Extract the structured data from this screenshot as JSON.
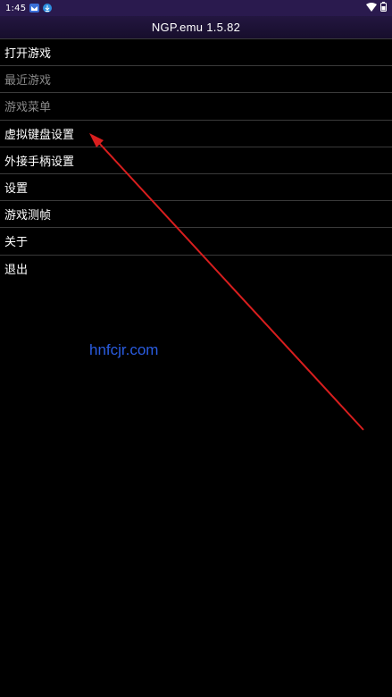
{
  "status_bar": {
    "time": "1:45"
  },
  "app_bar": {
    "title": "NGP.emu 1.5.82"
  },
  "menu": {
    "items": [
      {
        "label": "打开游戏",
        "enabled": true
      },
      {
        "label": "最近游戏",
        "enabled": false
      },
      {
        "label": "游戏菜单",
        "enabled": false
      },
      {
        "label": "虚拟键盘设置",
        "enabled": true
      },
      {
        "label": "外接手柄设置",
        "enabled": true
      },
      {
        "label": "设置",
        "enabled": true
      },
      {
        "label": "游戏测帧",
        "enabled": true
      },
      {
        "label": "关于",
        "enabled": true
      },
      {
        "label": "退出",
        "enabled": true
      }
    ]
  },
  "watermark": "hnfcjr.com",
  "colors": {
    "status_bar": "#2a1a4e",
    "app_bar": "#1d1236",
    "background": "#000000",
    "divider": "#3a3a3a",
    "disabled_text": "#8a8a8a",
    "watermark": "#2a5ce0",
    "annotation_arrow": "#d81e1e"
  },
  "icons": [
    "notification-app-icon",
    "download-icon",
    "wifi-icon",
    "battery-icon"
  ]
}
